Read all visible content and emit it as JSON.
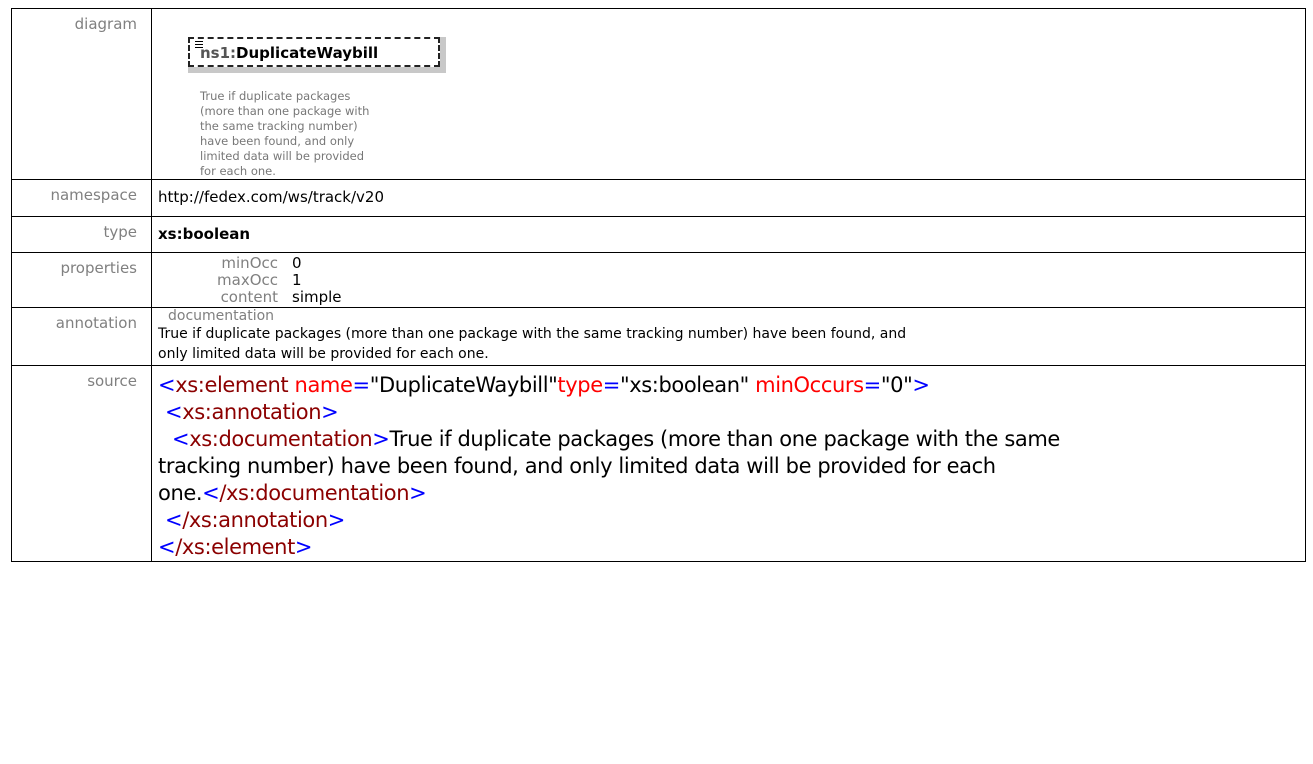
{
  "rows": {
    "diagram": {
      "label": "diagram",
      "element_prefix": "ns1:",
      "element_name": "DuplicateWaybill",
      "documentation_lines": [
        "True if duplicate packages",
        "(more than one package with",
        "the same tracking number)",
        "have been found, and only",
        "limited data will be provided",
        "for each one."
      ]
    },
    "namespace": {
      "label": "namespace",
      "value": "http://fedex.com/ws/track/v20"
    },
    "type": {
      "label": "type",
      "value": "xs:boolean"
    },
    "properties": {
      "label": "properties",
      "items": [
        {
          "key": "minOcc",
          "value": "0"
        },
        {
          "key": "maxOcc",
          "value": "1"
        },
        {
          "key": "content",
          "value": "simple"
        }
      ]
    },
    "annotation": {
      "label": "annotation",
      "heading": "documentation",
      "lines": [
        "True if duplicate packages (more than one package with the same tracking number) have been found, and",
        "only limited data will be provided  for each one."
      ]
    },
    "source": {
      "label": "source",
      "element_open_tag": "xs:element",
      "attr_name": "name",
      "attr_name_value": "\"DuplicateWaybill\"",
      "attr_type": "type",
      "attr_type_value": "\"xs:boolean\"",
      "attr_minoccurs": "minOccurs",
      "attr_minoccurs_value": "\"0\"",
      "annotation_tag": "xs:annotation",
      "documentation_tag": "xs:documentation",
      "doc_text_line1": "True if duplicate packages (more than one package with the same",
      "doc_text_line2": "tracking number) have been found, and only limited data will be provided for each",
      "doc_text_line3": "one.",
      "close_documentation": "/xs:documentation",
      "close_annotation": "/xs:annotation",
      "close_element": "/xs:element"
    }
  },
  "colors": {
    "tag": "#8b0000",
    "bracket": "#0000ff",
    "attribute": "#ff0000",
    "label": "#808080"
  }
}
